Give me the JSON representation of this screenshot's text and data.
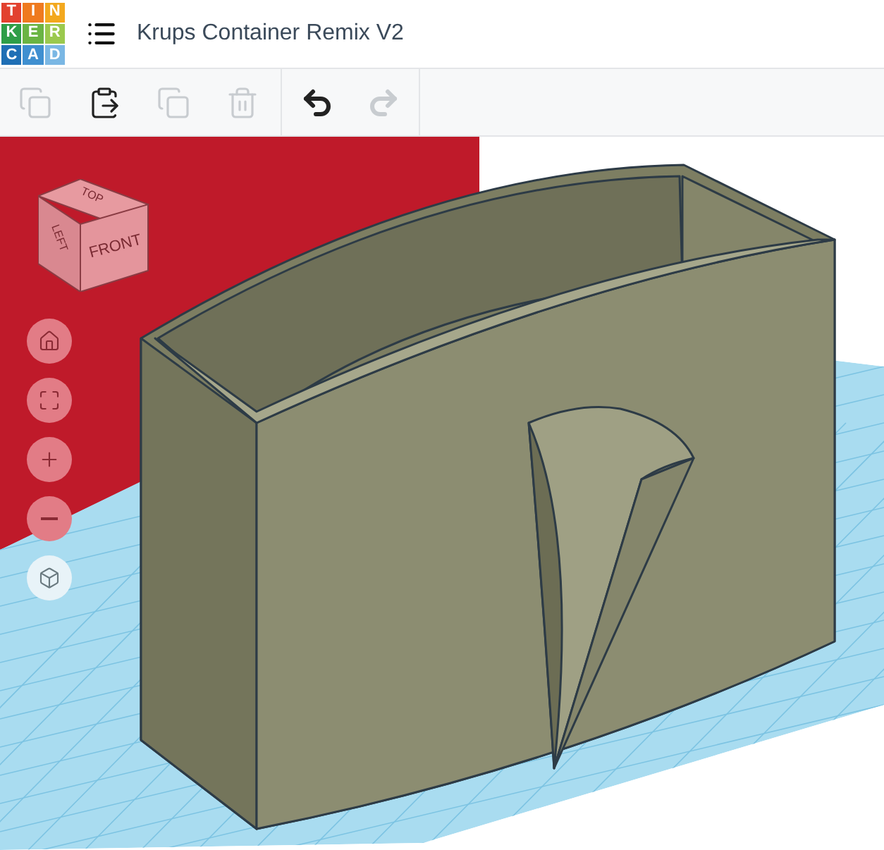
{
  "logo": {
    "letters": [
      "T",
      "I",
      "N",
      "K",
      "E",
      "R",
      "C",
      "A",
      "D"
    ]
  },
  "title": "Krups Container Remix V2",
  "toolbar": [
    {
      "kind": "copy",
      "disabled": true
    },
    {
      "kind": "paste",
      "disabled": false
    },
    {
      "kind": "duplicate",
      "disabled": true
    },
    {
      "kind": "delete",
      "disabled": true
    },
    {
      "kind": "undo",
      "disabled": false
    },
    {
      "kind": "redo",
      "disabled": true
    }
  ],
  "view_cube": {
    "top": "TOP",
    "left": "LEFT",
    "front": "FRONT"
  },
  "view_controls": [
    {
      "kind": "home"
    },
    {
      "kind": "fit"
    },
    {
      "kind": "zoom-in"
    },
    {
      "kind": "zoom-out"
    },
    {
      "kind": "ortho"
    }
  ]
}
